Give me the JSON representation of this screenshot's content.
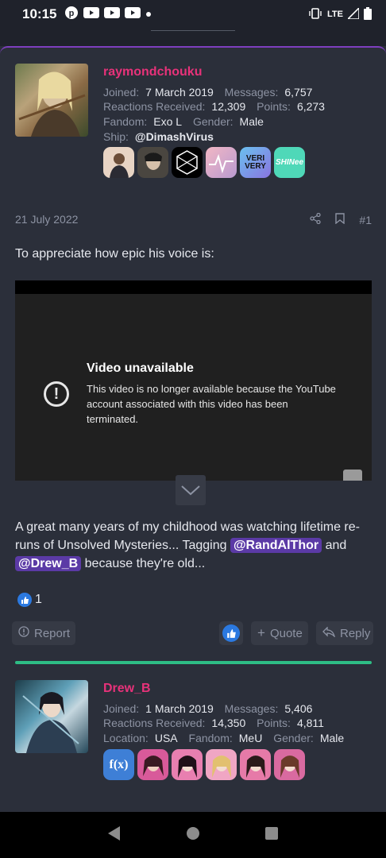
{
  "status": {
    "time": "10:15",
    "network": "LTE"
  },
  "post1": {
    "username": "raymondchouku",
    "joined_label": "Joined:",
    "joined": "7 March 2019",
    "messages_label": "Messages:",
    "messages": "6,757",
    "reactions_label": "Reactions Received:",
    "reactions": "12,309",
    "points_label": "Points:",
    "points": "6,273",
    "fandom_label": "Fandom:",
    "fandom": "Exo L",
    "gender_label": "Gender:",
    "gender": "Male",
    "ship_label": "Ship:",
    "ship": "@DimashVirus",
    "badges": [
      "portrait",
      "portrait",
      "exo-logo",
      "wave-logo",
      "verivery-logo",
      "shinee-logo"
    ],
    "badge_text": {
      "verivery": "VERI VERY",
      "shinee": "SHINee"
    },
    "date": "21 July 2022",
    "post_number": "#1",
    "intro": "To appreciate how epic his voice is:",
    "video": {
      "title": "Video unavailable",
      "message": "This video is no longer available because the YouTube account associated with this video has been terminated."
    },
    "text_before": "A great many years of my childhood was watching lifetime re-runs of Unsolved Mysteries... Tagging",
    "mention1": "@RandAlThor",
    "text_middle": "and",
    "mention2": "@Drew_B",
    "text_after": "because they're old...",
    "like_count": "1",
    "report_label": "Report",
    "quote_label": "Quote",
    "reply_label": "Reply"
  },
  "post2": {
    "username": "Drew_B",
    "joined_label": "Joined:",
    "joined": "1 March 2019",
    "messages_label": "Messages:",
    "messages": "5,406",
    "reactions_label": "Reactions Received:",
    "reactions": "14,350",
    "points_label": "Points:",
    "points": "4,811",
    "location_label": "Location:",
    "location": "USA",
    "fandom_label": "Fandom:",
    "fandom": "MeU",
    "gender_label": "Gender:",
    "gender": "Male",
    "badges": [
      "fx-logo",
      "portrait",
      "portrait",
      "portrait",
      "portrait",
      "portrait"
    ],
    "badge_text": {
      "fx": "f(x)"
    }
  },
  "colors": {
    "accent_pink": "#e8327a",
    "divider_green": "#2ebd85",
    "mention_purple": "#5b3aa6",
    "like_blue": "#2b79e0"
  }
}
